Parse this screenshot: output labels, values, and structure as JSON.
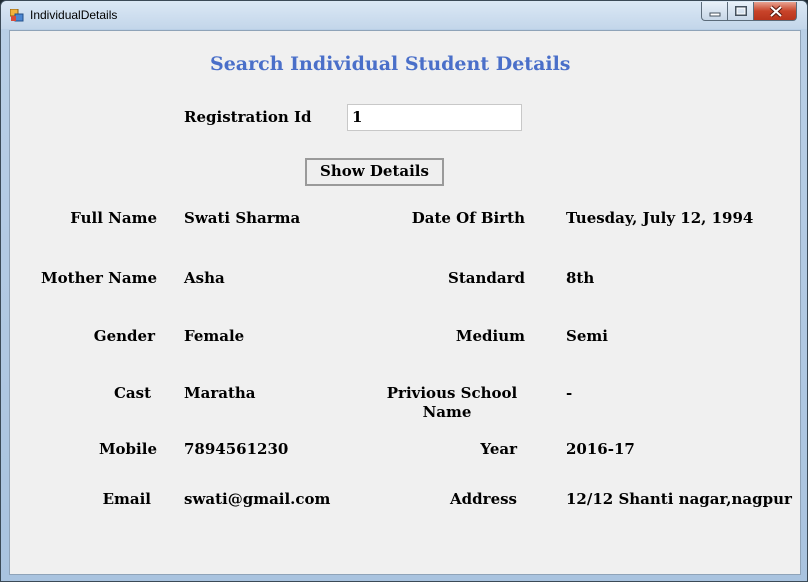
{
  "window": {
    "title": "IndividualDetails"
  },
  "form": {
    "heading": "Search Individual Student Details",
    "registration_label": "Registration Id",
    "registration_value": "1",
    "show_button": "Show Details"
  },
  "fields": {
    "full_name_label": "Full Name",
    "full_name_value": "Swati Sharma",
    "dob_label": "Date Of Birth",
    "dob_value": "Tuesday, July 12, 1994",
    "mother_label": "Mother Name",
    "mother_value": "Asha",
    "standard_label": "Standard",
    "standard_value": "8th",
    "gender_label": "Gender",
    "gender_value": "Female",
    "medium_label": "Medium",
    "medium_value": "Semi",
    "cast_label": "Cast",
    "cast_value": "Maratha",
    "prev_school_label_line1": "Privious School",
    "prev_school_label_line2": "Name",
    "prev_school_value": "-",
    "mobile_label": "Mobile",
    "mobile_value": "7894561230",
    "year_label": "Year",
    "year_value": "2016-17",
    "email_label": "Email",
    "email_value": "swati@gmail.com",
    "address_label": "Address",
    "address_value": "12/12 Shanti nagar,nagpur"
  }
}
